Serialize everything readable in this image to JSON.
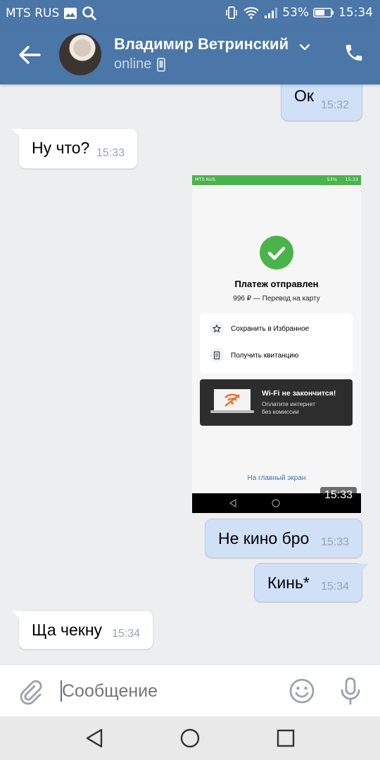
{
  "status_bar": {
    "carrier": "MTS RUS",
    "battery": "53%",
    "time": "15:34"
  },
  "header": {
    "name": "Владимир Ветринский",
    "status": "online"
  },
  "messages": [
    {
      "text": "Ок",
      "time": "15:32",
      "direction": "out"
    },
    {
      "text": "Ну что?",
      "time": "15:33",
      "direction": "in"
    },
    {
      "text": "Не кино бро",
      "time": "15:33",
      "direction": "out"
    },
    {
      "text": "Кинь*",
      "time": "15:34",
      "direction": "out"
    },
    {
      "text": "Ща чекну",
      "time": "15:34",
      "direction": "in"
    }
  ],
  "screenshot_attachment": {
    "time": "15:33",
    "status_carrier": "MTS RUS",
    "status_battery": "53%",
    "status_time": "15:33",
    "title": "Платеж отправлен",
    "subtitle": "996 ₽ — Перевод на карту",
    "action_save": "Сохранить в Избранное",
    "action_receipt": "Получить квитанцию",
    "ad_title": "Wi-Fi не закончится!",
    "ad_line1": "Оплатите интернет",
    "ad_line2": "без комиссии",
    "home_link": "На главный экран"
  },
  "composer": {
    "placeholder": "Сообщение"
  },
  "colors": {
    "header": "#4a76a8",
    "outgoing_bubble": "#cfe0f7",
    "incoming_bubble": "#ffffff",
    "background": "#edeef0",
    "success": "#4bb34b"
  }
}
